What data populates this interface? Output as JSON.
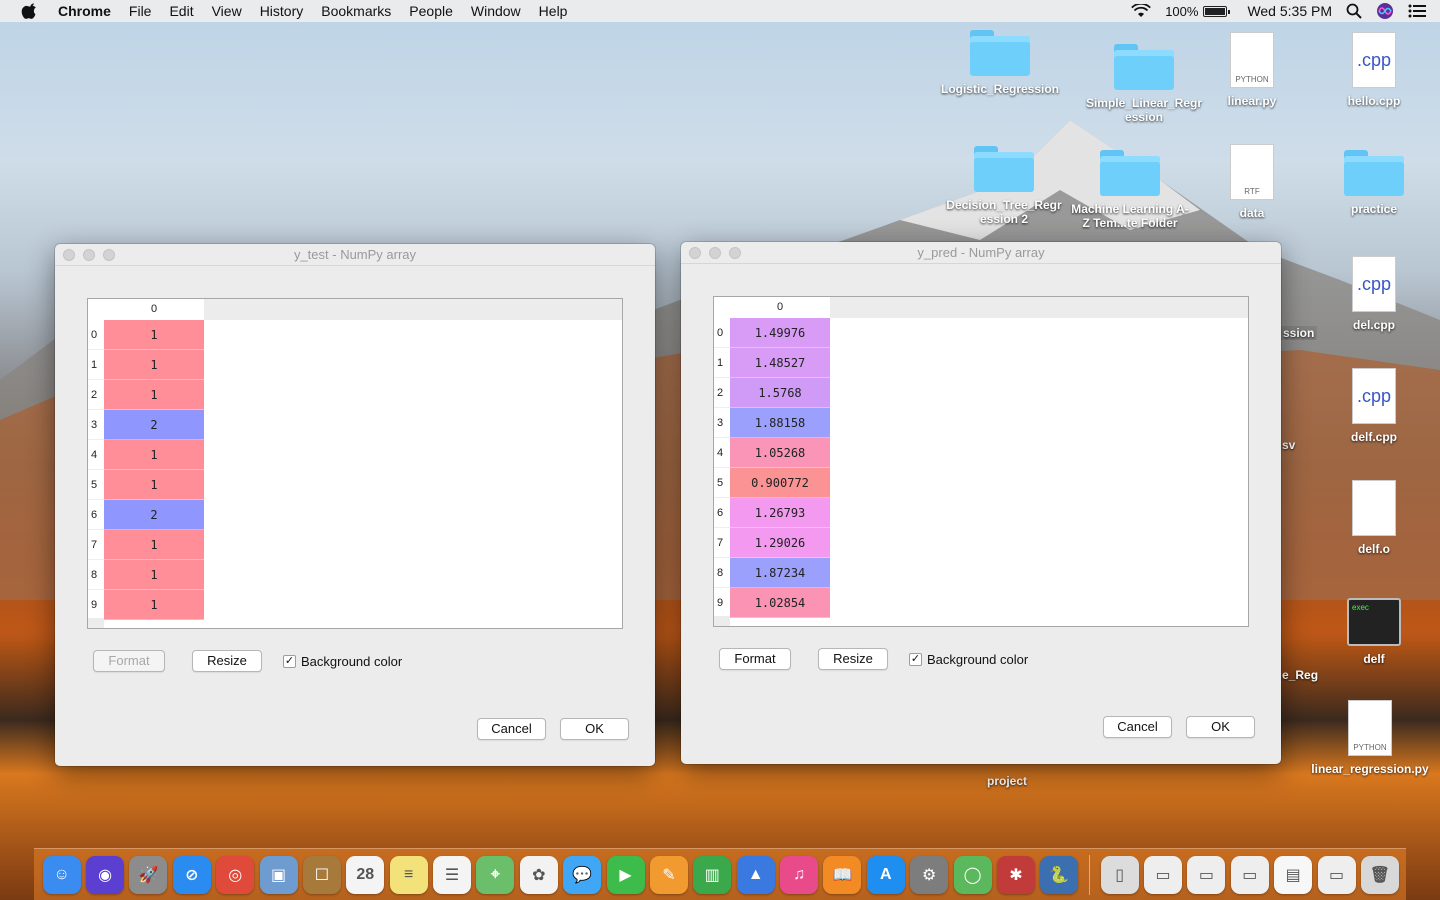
{
  "menubar": {
    "app": "Chrome",
    "items": [
      "File",
      "Edit",
      "View",
      "History",
      "Bookmarks",
      "People",
      "Window",
      "Help"
    ],
    "battery": "100%",
    "clock": "Wed 5:35 PM"
  },
  "desktop": {
    "icons": [
      {
        "label": "Logistic_Regression",
        "kind": "folder"
      },
      {
        "label": "Simple_Linear_Regression",
        "kind": "folder"
      },
      {
        "label": "linear.py",
        "kind": "doc",
        "badge": "PYTHON"
      },
      {
        "label": "hello.cpp",
        "kind": "cpp",
        "badge": ".cpp"
      },
      {
        "label": "Decision_Tree_Regression 2",
        "kind": "folder"
      },
      {
        "label": "Machine Learning A-Z Tem...te Folder",
        "kind": "folder"
      },
      {
        "label": "data",
        "kind": "doc",
        "badge": "RTF"
      },
      {
        "label": "practice",
        "kind": "folder"
      },
      {
        "label": "del.cpp",
        "kind": "cpp",
        "badge": ".cpp"
      },
      {
        "label": "delf.cpp",
        "kind": "cpp",
        "badge": ".cpp"
      },
      {
        "label": "delf.o",
        "kind": "doc",
        "badge": ""
      },
      {
        "label": "delf",
        "kind": "exec",
        "badge": "exec"
      },
      {
        "label": "linear_regression.py",
        "kind": "doc",
        "badge": "PYTHON"
      }
    ],
    "partial_labels": [
      "ssion",
      "sv",
      "e_Reg",
      "project"
    ]
  },
  "window_test": {
    "title": "y_test - NumPy array",
    "column_header": "0",
    "rows": [
      {
        "index": "0",
        "value": "1",
        "color": "#ff8e98"
      },
      {
        "index": "1",
        "value": "1",
        "color": "#ff8e98"
      },
      {
        "index": "2",
        "value": "1",
        "color": "#ff8e98"
      },
      {
        "index": "3",
        "value": "2",
        "color": "#8f97ff"
      },
      {
        "index": "4",
        "value": "1",
        "color": "#ff8e98"
      },
      {
        "index": "5",
        "value": "1",
        "color": "#ff8e98"
      },
      {
        "index": "6",
        "value": "2",
        "color": "#8f97ff"
      },
      {
        "index": "7",
        "value": "1",
        "color": "#ff8e98"
      },
      {
        "index": "8",
        "value": "1",
        "color": "#ff8e98"
      },
      {
        "index": "9",
        "value": "1",
        "color": "#ff8e98"
      }
    ],
    "format_label": "Format",
    "resize_label": "Resize",
    "bgcolor_label": "Background color",
    "cancel_label": "Cancel",
    "ok_label": "OK"
  },
  "window_pred": {
    "title": "y_pred - NumPy array",
    "column_header": "0",
    "rows": [
      {
        "index": "0",
        "value": "1.49976",
        "color": "#d89cf6"
      },
      {
        "index": "1",
        "value": "1.48527",
        "color": "#d89cf6"
      },
      {
        "index": "2",
        "value": "1.5768",
        "color": "#cf9bf7"
      },
      {
        "index": "3",
        "value": "1.88158",
        "color": "#9aa0fb"
      },
      {
        "index": "4",
        "value": "1.05268",
        "color": "#fb95b8"
      },
      {
        "index": "5",
        "value": "0.900772",
        "color": "#fb9294"
      },
      {
        "index": "6",
        "value": "1.26793",
        "color": "#f39af0"
      },
      {
        "index": "7",
        "value": "1.29026",
        "color": "#f39af0"
      },
      {
        "index": "8",
        "value": "1.87234",
        "color": "#9aa0fb"
      },
      {
        "index": "9",
        "value": "1.02854",
        "color": "#fb94b4"
      }
    ],
    "format_label": "Format",
    "resize_label": "Resize",
    "bgcolor_label": "Background color",
    "cancel_label": "Cancel",
    "ok_label": "OK"
  },
  "dock": {
    "apps": [
      {
        "name": "finder-icon",
        "color": "#3b8cf0",
        "glyph": "☺"
      },
      {
        "name": "siri-icon",
        "color": "#5a3fd1",
        "glyph": "◉"
      },
      {
        "name": "launchpad-icon",
        "color": "#8c8c8c",
        "glyph": "🚀"
      },
      {
        "name": "safari-icon",
        "color": "#2a8cf0",
        "glyph": "⊘"
      },
      {
        "name": "chrome-icon",
        "color": "#e04a3a",
        "glyph": "◎"
      },
      {
        "name": "preview-icon",
        "color": "#6e9bd0",
        "glyph": "▣"
      },
      {
        "name": "notes-book-icon",
        "color": "#a77a3b",
        "glyph": "☐"
      },
      {
        "name": "calendar-icon",
        "color": "#f4f4f4",
        "glyph": "28"
      },
      {
        "name": "notes-icon",
        "color": "#f3e27a",
        "glyph": "≡"
      },
      {
        "name": "reminders-icon",
        "color": "#f4f4f4",
        "glyph": "☰"
      },
      {
        "name": "maps-icon",
        "color": "#6cbf6a",
        "glyph": "⌖"
      },
      {
        "name": "photos-icon",
        "color": "#f2f2f2",
        "glyph": "✿"
      },
      {
        "name": "messages-icon",
        "color": "#3fa7f5",
        "glyph": "💬"
      },
      {
        "name": "facetime-icon",
        "color": "#3dbb4b",
        "glyph": "▶"
      },
      {
        "name": "pages-icon",
        "color": "#f19a2f",
        "glyph": "✎"
      },
      {
        "name": "numbers-icon",
        "color": "#3ca84c",
        "glyph": "▥"
      },
      {
        "name": "keynote-icon",
        "color": "#3a7ae0",
        "glyph": "▲"
      },
      {
        "name": "itunes-icon",
        "color": "#e84a8a",
        "glyph": "♫"
      },
      {
        "name": "ibooks-icon",
        "color": "#f38b24",
        "glyph": "📖"
      },
      {
        "name": "appstore-icon",
        "color": "#1f8ef1",
        "glyph": "A"
      },
      {
        "name": "system-preferences-icon",
        "color": "#7d7d7d",
        "glyph": "⚙"
      },
      {
        "name": "anaconda-icon",
        "color": "#5cb85c",
        "glyph": "◯"
      },
      {
        "name": "spyder-icon",
        "color": "#c23b3b",
        "glyph": "✱"
      },
      {
        "name": "python-icon",
        "color": "#3b6fb0",
        "glyph": "🐍"
      }
    ],
    "right_items": [
      {
        "name": "archive-icon",
        "color": "#dcdcdc",
        "glyph": "▯"
      },
      {
        "name": "window-thumb-1-icon",
        "color": "#eeeeee",
        "glyph": "▭"
      },
      {
        "name": "window-thumb-2-icon",
        "color": "#eeeeee",
        "glyph": "▭"
      },
      {
        "name": "window-thumb-3-icon",
        "color": "#eeeeee",
        "glyph": "▭"
      },
      {
        "name": "document-thumb-icon",
        "color": "#f7f7f7",
        "glyph": "▤"
      },
      {
        "name": "chrome-window-thumb-icon",
        "color": "#eeeeee",
        "glyph": "▭"
      },
      {
        "name": "trash-icon",
        "color": "#d8d8d8",
        "glyph": "🗑"
      }
    ]
  }
}
